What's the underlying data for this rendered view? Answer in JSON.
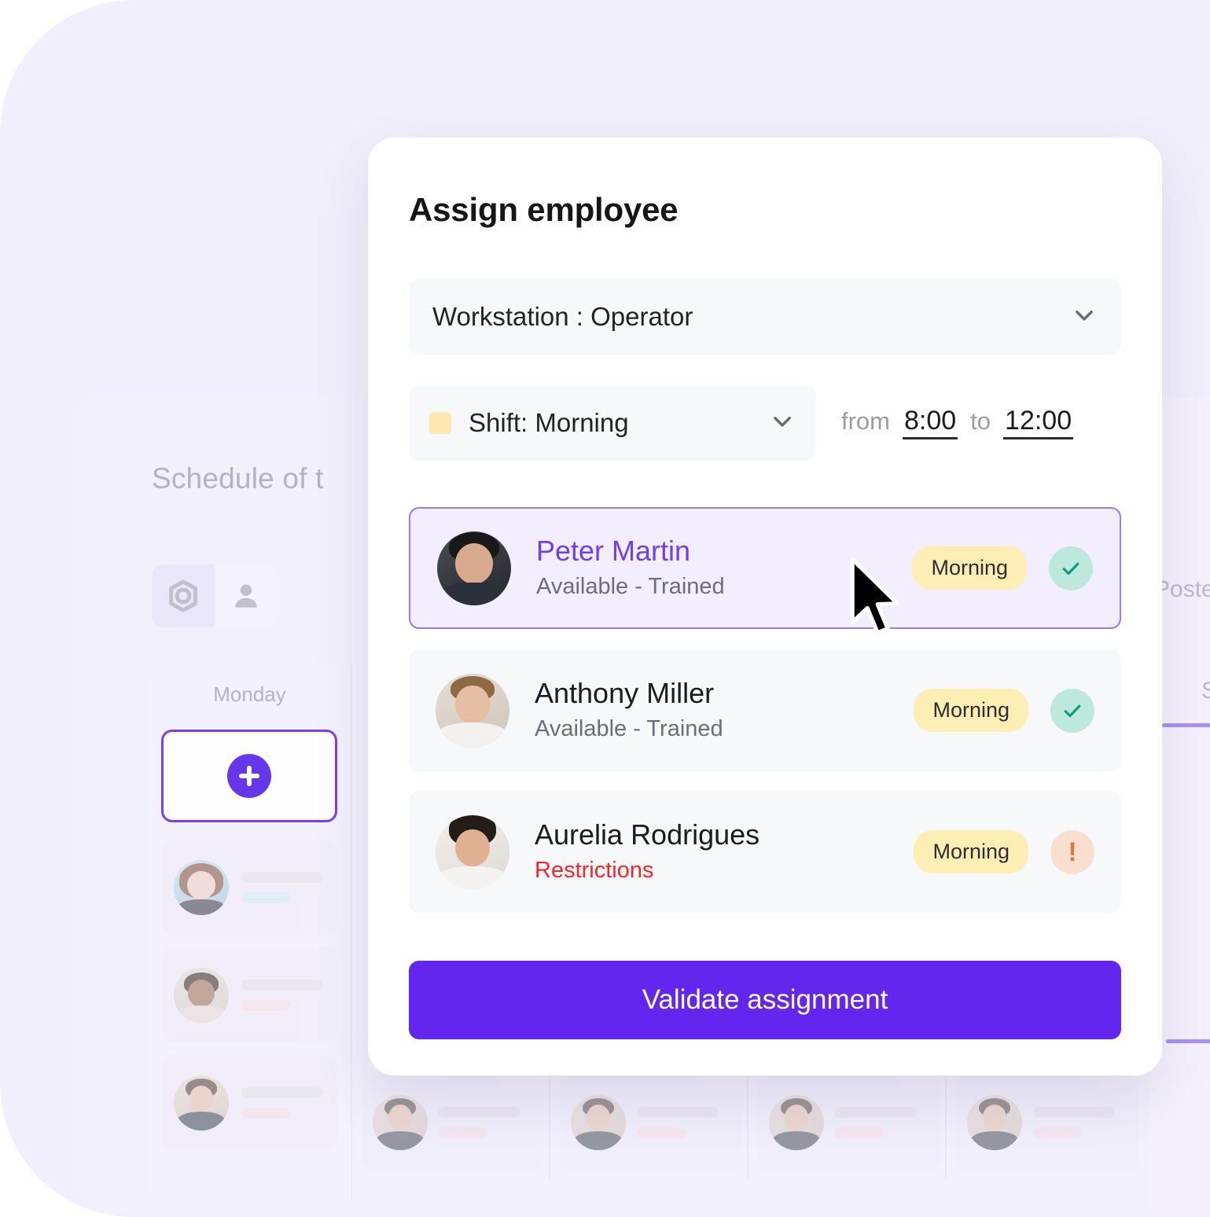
{
  "background_app": {
    "title": "Schedule of t",
    "view_toggle": [
      {
        "name": "workstation-view",
        "icon": "hexagon-nut-icon",
        "active": true
      },
      {
        "name": "employee-view",
        "icon": "person-icon",
        "active": false
      }
    ],
    "day_column": {
      "day_label": "Monday",
      "add_button_icon": "plus-icon"
    },
    "right_panel": {
      "column_header_partial": "Poste",
      "secondary_partial": "S"
    }
  },
  "modal": {
    "title": "Assign employee",
    "workstation_select": {
      "value": "Workstation : Operator",
      "icon": "chevron-down-icon"
    },
    "shift_select": {
      "value": "Shift: Morning",
      "swatch_color": "#fde8b0",
      "icon": "chevron-down-icon"
    },
    "time_range": {
      "from_label": "from",
      "from_value": "8:00",
      "to_label": "to",
      "to_value": "12:00"
    },
    "employees": [
      {
        "name": "Peter Martin",
        "status": "Available - Trained",
        "status_type": "ok",
        "badge": "Morning",
        "indicator_icon": "check-icon",
        "indicator_type": "ok",
        "selected": true
      },
      {
        "name": "Anthony Miller",
        "status": "Available - Trained",
        "status_type": "ok",
        "badge": "Morning",
        "indicator_icon": "check-icon",
        "indicator_type": "ok",
        "selected": false
      },
      {
        "name": "Aurelia Rodrigues",
        "status": "Restrictions",
        "status_type": "warn",
        "badge": "Morning",
        "indicator_icon": "exclamation-icon",
        "indicator_type": "alert",
        "selected": false
      }
    ],
    "validate_button": "Validate assignment"
  },
  "colors": {
    "page_background": "#f1effb",
    "accent_purple": "#6326ef",
    "selected_row_bg": "#f3eefe",
    "selected_row_border": "#9b7bf0",
    "badge_yellow": "#fdeeb4",
    "ok_green": "#bce9dc",
    "alert_peach": "#f8dfd0",
    "warn_red": "#f5252a",
    "name_highlight": "#6c40ef"
  }
}
